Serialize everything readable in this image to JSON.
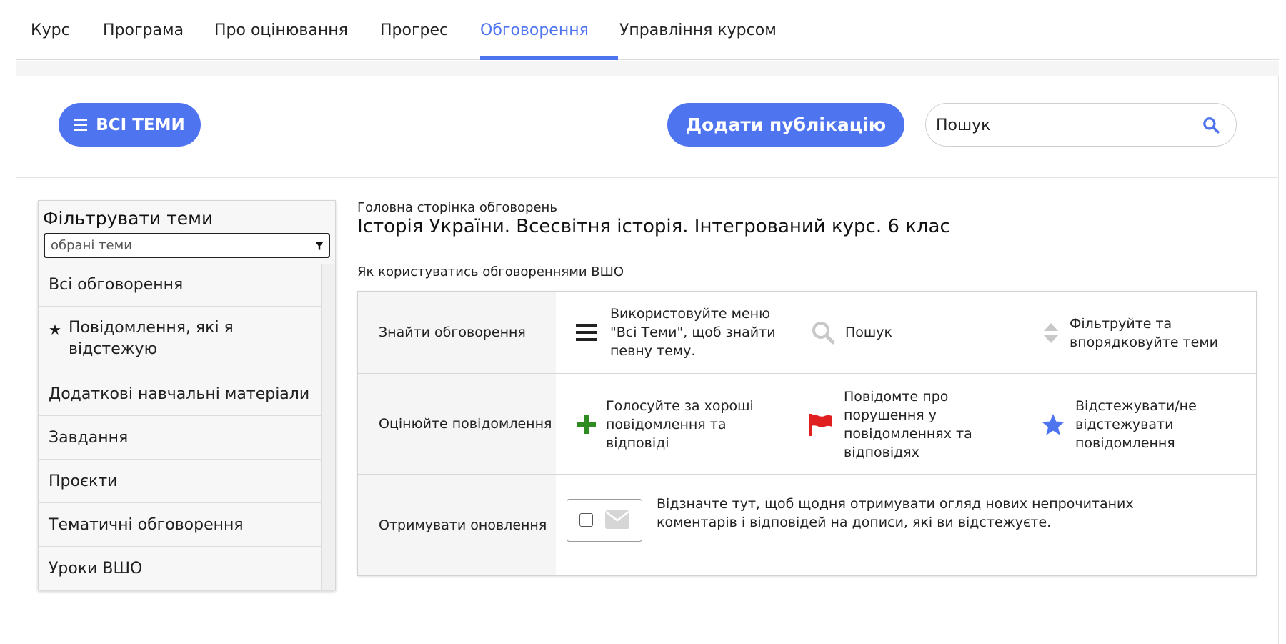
{
  "tabs": [
    {
      "label": "Курс"
    },
    {
      "label": "Програма"
    },
    {
      "label": "Про оцінювання"
    },
    {
      "label": "Прогрес"
    },
    {
      "label": "Обговорення",
      "active": true
    },
    {
      "label": "Управління курсом"
    }
  ],
  "toolbar": {
    "all_topics_label": "ВСІ ТЕМИ",
    "add_post_label": "Додати публікацію",
    "search_placeholder": "Пошук"
  },
  "filter": {
    "title": "Фільтрувати теми",
    "select_value": "обрані теми",
    "items": [
      {
        "label": "Всі обговорення"
      },
      {
        "label": "Повідомлення, які я відстежую",
        "icon": "star-icon"
      },
      {
        "label": "Додаткові навчальні матеріали"
      },
      {
        "label": "Завдання"
      },
      {
        "label": "Проєкти"
      },
      {
        "label": "Тематичні обговорення"
      },
      {
        "label": "Уроки ВШО"
      }
    ]
  },
  "main": {
    "breadcrumb": "Головна сторінка обговорень",
    "course_title": "Історія України. Всесвітня історія. Інтегрований курс. 6 клас",
    "howto_heading": "Як користуватись обговореннями ВШО",
    "guide": {
      "rows": [
        {
          "label": "Знайти обговорення",
          "cells": [
            {
              "icon": "menu-icon",
              "text": "Використовуйте меню \"Всі Теми\", щоб знайти певну тему."
            },
            {
              "icon": "search-icon",
              "text": "Пошук"
            },
            {
              "icon": "sort-icon",
              "text": "Фільтруйте та впорядковуйте теми"
            }
          ]
        },
        {
          "label": "Оцінюйте повідомлення",
          "cells": [
            {
              "icon": "plus-icon",
              "text": "Голосуйте за хороші повідомлення та відповіді"
            },
            {
              "icon": "flag-icon",
              "text": "Повідомте про порушення у повідомленнях та відповідях"
            },
            {
              "icon": "star-icon",
              "text": "Відстежувати/не відстежувати повідомлення"
            }
          ]
        },
        {
          "label": "Отримувати оновлення",
          "digest_text": "Відзначте тут, щоб щодня отримувати огляд нових непрочитаних коментарів і відповідей на дописи, які ви відстежуєте.",
          "digest_checked": false
        }
      ]
    }
  },
  "colors": {
    "accent": "#4f74f0",
    "plus_green": "#2e8b22",
    "flag_red": "#e02020",
    "star_blue": "#4f74f0"
  }
}
